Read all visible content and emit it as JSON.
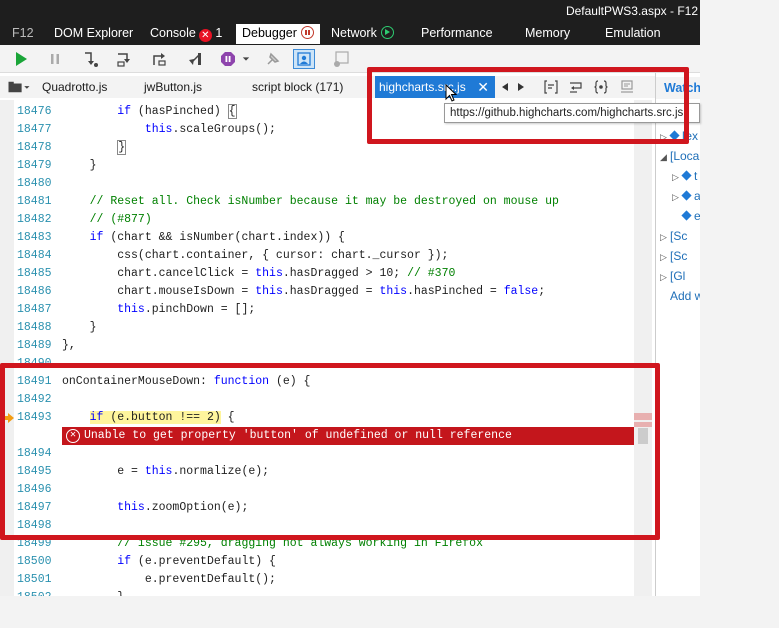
{
  "window": {
    "title": "DefaultPWS3.aspx - F12"
  },
  "top_tabs": [
    {
      "label": "F12"
    },
    {
      "label": "DOM Explorer"
    },
    {
      "label": "Console",
      "error_count": "1"
    },
    {
      "label": "Debugger"
    },
    {
      "label": "Network"
    },
    {
      "label": "Performance"
    },
    {
      "label": "Memory"
    },
    {
      "label": "Emulation"
    }
  ],
  "file_tabs": [
    {
      "label": "Quadrotto.js"
    },
    {
      "label": "jwButton.js"
    },
    {
      "label": "script block (171)"
    },
    {
      "label": "highcharts.src.js",
      "close": "✕"
    }
  ],
  "tooltip": {
    "text": "https://github.highcharts.com/highcharts.src.js"
  },
  "watch": {
    "title": "Watches",
    "rows": [
      "[ex",
      "[Loca",
      "t",
      "a",
      "e",
      "[Sc",
      "[Sc",
      "[Gl",
      "Add w"
    ]
  },
  "code_lines": [
    {
      "num": "18476",
      "html": "        <span class=\"kw\">if</span> (hasPinched) <span class=\"cursor-box\">{</span>"
    },
    {
      "num": "18477",
      "html": "            <span class=\"kw\">this</span>.scaleGroups();"
    },
    {
      "num": "18478",
      "html": "        <span class=\"cursor-box\">}</span>"
    },
    {
      "num": "18479",
      "html": "    }"
    },
    {
      "num": "18480",
      "html": ""
    },
    {
      "num": "18481",
      "html": "    <span class=\"cm\">// Reset all. Check isNumber because it may be destroyed on mouse up</span>"
    },
    {
      "num": "18482",
      "html": "    <span class=\"cm\">// (#877)</span>"
    },
    {
      "num": "18483",
      "html": "    <span class=\"kw\">if</span> (chart &amp;&amp; isNumber(chart.index)) {"
    },
    {
      "num": "18484",
      "html": "        css(chart.container, { cursor: chart._cursor });"
    },
    {
      "num": "18485",
      "html": "        chart.cancelClick = <span class=\"kw\">this</span>.hasDragged &gt; 10; <span class=\"cm\">// #370</span>"
    },
    {
      "num": "18486",
      "html": "        chart.mouseIsDown = <span class=\"kw\">this</span>.hasDragged = <span class=\"kw\">this</span>.hasPinched = <span class=\"kw\">false</span>;"
    },
    {
      "num": "18487",
      "html": "        <span class=\"kw\">this</span>.pinchDown = [];"
    },
    {
      "num": "18488",
      "html": "    }"
    },
    {
      "num": "18489",
      "html": "},"
    },
    {
      "num": "18490",
      "html": ""
    },
    {
      "num": "18491",
      "html": "onContainerMouseDown: <span class=\"kw\">function</span> (e) {"
    },
    {
      "num": "18492",
      "html": ""
    },
    {
      "num": "18493",
      "html": "    <span class=\"hl\"><span class=\"kw\">if</span> (e.button !== 2)</span> {"
    },
    {
      "num": "",
      "html": ""
    },
    {
      "num": "18494",
      "html": ""
    },
    {
      "num": "18495",
      "html": "        e = <span class=\"kw\">this</span>.normalize(e);"
    },
    {
      "num": "18496",
      "html": ""
    },
    {
      "num": "18497",
      "html": "        <span class=\"kw\">this</span>.zoomOption(e);"
    },
    {
      "num": "18498",
      "html": ""
    },
    {
      "num": "18499",
      "html": "        <span class=\"cm\">// issue #295, dragging not always working in Firefox</span>"
    },
    {
      "num": "18500",
      "html": "        <span class=\"kw\">if</span> (e.preventDefault) {"
    },
    {
      "num": "18501",
      "html": "            e.preventDefault();"
    },
    {
      "num": "18502",
      "html": "        }"
    }
  ],
  "error": {
    "message": "Unable to get property 'button' of undefined or null reference"
  },
  "colors": {
    "accent": "#1f7ad6",
    "annotation_red": "#d0161e",
    "error_bar": "#c4161c"
  }
}
